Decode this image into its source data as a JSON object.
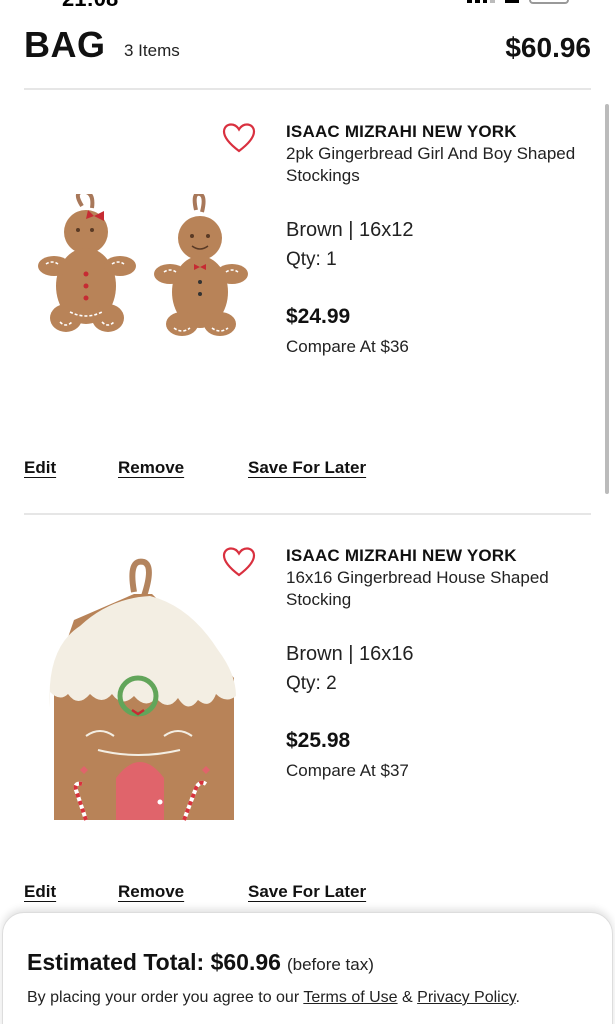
{
  "status_bar": {
    "time": "21:08"
  },
  "header": {
    "title": "BAG",
    "item_count": "3 Items",
    "total": "$60.96"
  },
  "items": [
    {
      "brand": "ISAAC MIZRAHI NEW YORK",
      "description": "2pk Gingerbread Girl And Boy Shaped Stockings",
      "attributes": "Brown | 16x12",
      "qty": "Qty: 1",
      "price": "$24.99",
      "compare": "Compare At $36",
      "image_icon": "gingerbread-stockings-image"
    },
    {
      "brand": "ISAAC MIZRAHI NEW YORK",
      "description": "16x16 Gingerbread House Shaped Stocking",
      "attributes": "Brown | 16x16",
      "qty": "Qty: 2",
      "price": "$25.98",
      "compare": "Compare At $37",
      "image_icon": "gingerbread-house-stocking-image"
    }
  ],
  "actions": {
    "edit": "Edit",
    "remove": "Remove",
    "save_for_later": "Save For Later"
  },
  "footer": {
    "estimated_label": "Estimated Total: $60.96",
    "estimated_note": "(before tax)",
    "legal_prefix": "By placing your order you agree to our",
    "terms": "Terms of Use",
    "amp": "&",
    "privacy": "Privacy Policy",
    "legal_suffix": "."
  },
  "colors": {
    "heart": "#d9303f",
    "accent_text": "#111111",
    "divider": "#e6e6e6"
  }
}
